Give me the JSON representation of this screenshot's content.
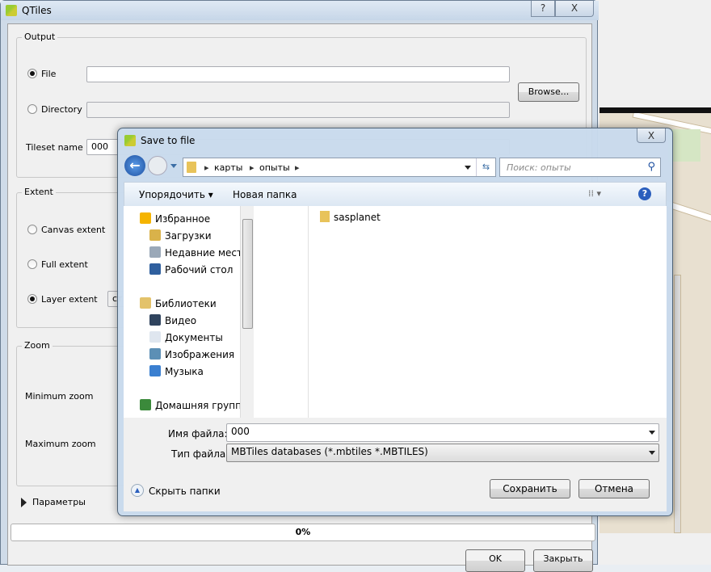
{
  "qtiles": {
    "title": "QTiles",
    "help": "?",
    "close": "X",
    "output": {
      "label": "Output",
      "file_label": "File",
      "file_value": "",
      "directory_label": "Directory",
      "directory_value": "",
      "browse": "Browse...",
      "tileset_label": "Tileset name",
      "tileset_value": "000"
    },
    "extent": {
      "label": "Extent",
      "canvas": "Canvas extent",
      "full": "Full extent",
      "layer": "Layer extent",
      "layer_value": "ст"
    },
    "zoom": {
      "label": "Zoom",
      "min": "Minimum zoom",
      "max": "Maximum zoom"
    },
    "params": "Параметры",
    "progress": "0%",
    "progress_value": 0,
    "ok": "OK",
    "close_btn": "Закрыть"
  },
  "save_dialog": {
    "title": "Save to file",
    "close": "X",
    "breadcrumb": [
      "карты",
      "опыты"
    ],
    "search_placeholder": "Поиск: опыты",
    "organize": "Упорядочить",
    "new_folder": "Новая папка",
    "nav": [
      {
        "label": "Избранное",
        "icon": "star-icon",
        "color": "#f5b400"
      },
      {
        "label": "Загрузки",
        "icon": "downloads-icon",
        "color": "#d9b24a"
      },
      {
        "label": "Недавние места",
        "icon": "recent-places-icon",
        "color": "#9aa8b8"
      },
      {
        "label": "Рабочий стол",
        "icon": "desktop-icon",
        "color": "#2f5f9e"
      },
      {
        "label": "Библиотеки",
        "icon": "libraries-icon",
        "color": "#e3c26a"
      },
      {
        "label": "Видео",
        "icon": "video-icon",
        "color": "#30445e"
      },
      {
        "label": "Документы",
        "icon": "documents-icon",
        "color": "#dfe6ef"
      },
      {
        "label": "Изображения",
        "icon": "pictures-icon",
        "color": "#5c8fb5"
      },
      {
        "label": "Музыка",
        "icon": "music-icon",
        "color": "#3a7fd0"
      },
      {
        "label": "Домашняя группа",
        "icon": "homegroup-icon",
        "color": "#3b8a3b"
      }
    ],
    "files": [
      {
        "name": "sasplanet",
        "type": "folder"
      }
    ],
    "filename_label": "Имя файла:",
    "filename_value": "000",
    "filetype_label": "Тип файла:",
    "filetype_value": "MBTiles databases (*.mbtiles *.MBTILES)",
    "hide_folders": "Скрыть папки",
    "save": "Сохранить",
    "cancel": "Отмена"
  }
}
